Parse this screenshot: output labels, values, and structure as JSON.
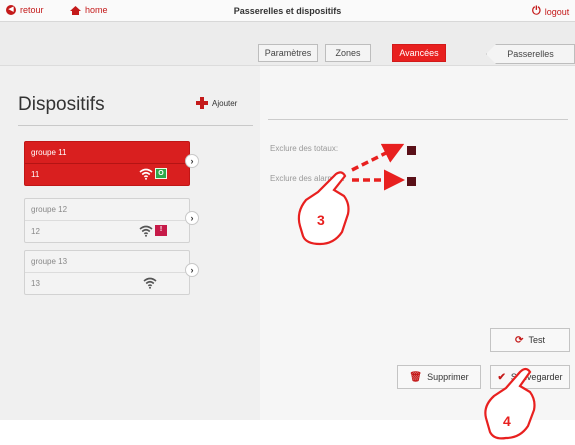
{
  "topbar": {
    "back_label": "retour",
    "home_label": "home",
    "title": "Passerelles et dispositifs",
    "logout_label": "logout"
  },
  "tabs": [
    {
      "label": "Paramètres",
      "active": false
    },
    {
      "label": "Zones",
      "active": false
    },
    {
      "label": "Avancées",
      "active": true
    }
  ],
  "passerelles_label": "Passerelles",
  "sidebar": {
    "heading": "Dispositifs",
    "add_label": "Ajouter",
    "devices": [
      {
        "name": "groupe 11",
        "id": "11",
        "status": "green",
        "status_glyph": "O",
        "selected": true
      },
      {
        "name": "groupe 12",
        "id": "12",
        "status": "red",
        "status_glyph": "!",
        "selected": false
      },
      {
        "name": "groupe 13",
        "id": "13",
        "status": "none",
        "status_glyph": "",
        "selected": false
      }
    ]
  },
  "options": {
    "exclude_totals_label": "Exclure des totaux:",
    "exclude_alarms_label": "Exclure des alarmes:"
  },
  "actions": {
    "test_label": "Test",
    "delete_label": "Supprimer",
    "save_label": "Sauvegarder"
  },
  "annotations": {
    "step_3": "3",
    "step_4": "4"
  },
  "colors": {
    "accent": "#e8201f",
    "checkbox": "#5a1018",
    "status_green": "#2fa84a",
    "status_red": "#c61a48"
  }
}
